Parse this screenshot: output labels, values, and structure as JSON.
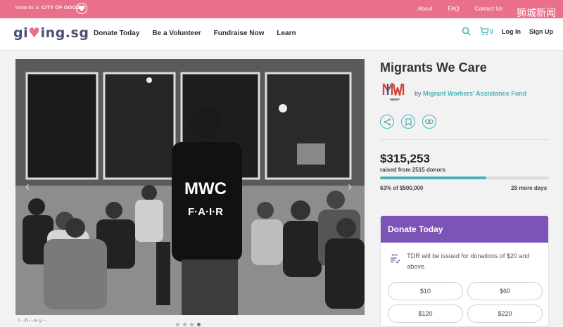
{
  "topbar": {
    "tagline_prefix": "towards a",
    "tagline_strong": "CITY OF GOOD",
    "links": [
      "About",
      "FAQ",
      "Contact Us"
    ],
    "watermark": "狮城新闻"
  },
  "nav": {
    "logo_a": "gi",
    "logo_b": "ing.sg",
    "links": [
      "Donate Today",
      "Be a Volunteer",
      "Fundraise Now",
      "Learn"
    ],
    "cart_count": "0",
    "login": "Log In",
    "signup": "Sign Up"
  },
  "photo": {
    "vest_line1": "MWC",
    "vest_line2": "F·A·I·R",
    "caption": "i···h···e·y···"
  },
  "campaign": {
    "title": "Migrants We Care",
    "by": "by",
    "org_name": "Migrant Workers' Assistance Fund",
    "org_logo_text": "MWAF",
    "amount": "$315,253",
    "raised_text": "raised from 2515 donors",
    "progress_fraction": 0.63,
    "pct_text": "63% of $500,000",
    "days_text": "28 more days"
  },
  "donate": {
    "heading": "Donate Today",
    "tdr_label": "TAX",
    "tdr_text": "TDR will be issued for donations of $20 and above.",
    "amounts": [
      "$10",
      "$60",
      "$120",
      "$220"
    ]
  },
  "colors": {
    "brand_pink": "#ea6f8a",
    "accent_teal": "#4bb3b8",
    "donate_purple": "#7b54b5"
  }
}
